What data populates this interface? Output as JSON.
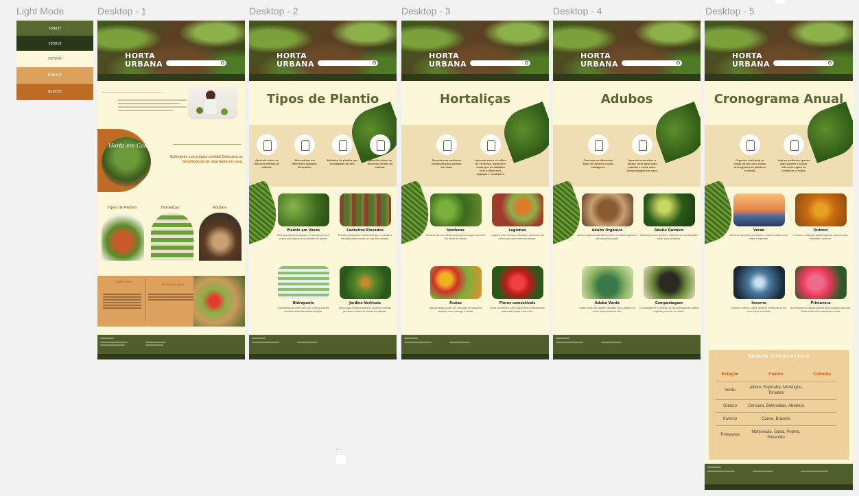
{
  "palette": {
    "title": "Light Mode",
    "swatches": [
      {
        "hex": "#59682F",
        "label": "59682F"
      },
      {
        "hex": "#283818",
        "label": "283818"
      },
      {
        "hex": "#FEF9DD",
        "label": "FEF9DD"
      },
      {
        "hex": "#DDA15E",
        "label": "DDA15E"
      },
      {
        "hex": "#BC6C25",
        "label": "BC6C25"
      }
    ]
  },
  "frames": {
    "d1": {
      "name": "Desktop - 1"
    },
    "d2": {
      "name": "Desktop - 2"
    },
    "d3": {
      "name": "Desktop - 3"
    },
    "d4": {
      "name": "Desktop - 4"
    },
    "d5": {
      "name": "Desktop - 5"
    }
  },
  "brand": {
    "logo_line1": "HORTA",
    "logo_line2": "URBANA"
  },
  "home": {
    "tagline": "Cultivando sua própria comida! Descubra os benefícios de ter uma horta em casa.",
    "topics": [
      "Tipos de Plantio",
      "Hortaliças",
      "Adubos"
    ],
    "promo_left": "Saiba mais",
    "promo_right": "Recursos úteis"
  },
  "tipos": {
    "title": "Tipos de Plantio",
    "features": [
      "Aprenda sobre os diversos formas de cultivar.",
      "Alternativas em diferentes espaços. Descubra!",
      "Métodos de plantio que se adaptam ao seu.",
      "Aprenda sobre os diversos formas de cultivar."
    ],
    "cards": [
      {
        "title": "Plantio em Vasos",
        "text": "Ideal para pequenos espaços, os vasos podem ser usados para cultivar uma variedade de plantas."
      },
      {
        "title": "Canteiros Elevados",
        "text": "Perfeitos para jardins e áreas externas, os canteiros elevados proporcionam um solo bem drenado."
      },
      {
        "title": "Hidroponia",
        "text": "Uma técnica de cultivo sem solo, onde as plantas recebem nutrientes através de água."
      },
      {
        "title": "Jardins Verticais",
        "text": "Ótimos para espaços limitados, os jardins verticais permitem o cultivo de plantas em paredes."
      }
    ]
  },
  "hortalicas": {
    "title": "Hortaliças",
    "features": [
      "Descubra as melhores hortaliças para cultivar em casa.",
      "Aprenda sobre o cultivo de verduras, legumes e ervas que se adaptam bem a diferentes espaços e condições."
    ],
    "cards": [
      {
        "title": "Verduras",
        "text": "Verduras são uma ótima escolha para começar sua horta. São fáceis de cultivar."
      },
      {
        "title": "Legumes",
        "text": "Legumes como cenoura, beterraba e abobrinha são ótimos para quem tem mais espaço."
      },
      {
        "title": "Frutas",
        "text": "Algumas frutas podem ser cultivadas em pequenos espaços, como morango e tomate."
      },
      {
        "title": "Flores comestíveis",
        "text": "Flores comestíveis como capuchinha e calêndula são adicionais bonitas à sua horta."
      }
    ]
  },
  "adubos": {
    "title": "Adubos",
    "features": [
      "Conheça os diferentes tipos de adubos e suas vantagens.",
      "Aprenda a escolher o adubo certo para suas plantas e como fazer compostagem em casa."
    ],
    "cards": [
      {
        "title": "Adubo Orgânico",
        "text": "Adubos orgânicos são feitos a partir de matéria orgânica e são uma ótima opção."
      },
      {
        "title": "Adubo Químico",
        "text": "Adubos químicos fornecem nutrientes de forma rápida e eficaz para as plantas."
      },
      {
        "title": "Adubo Verde",
        "text": "Adubo verde são plantas cultivadas com o objetivo de serem incorporadas ao solo."
      },
      {
        "title": "Compostagem",
        "text": "Compostagem é o processo de decomposição de matéria orgânica para criar um adubo."
      }
    ]
  },
  "cronograma": {
    "title": "Cronograma Anual",
    "features": [
      "Organize sua horta ao longo do ano com nosso cronograma de plantio e colheita.",
      "Veja as melhores épocas para plantar e colher diferentes tipos de hortaliças e frutas."
    ],
    "cards": [
      {
        "title": "Verão",
        "text": "No verão, aproveite para plantar e colher verduras como alface e espinafre."
      },
      {
        "title": "Outono",
        "text": "O outono é ideal para plantar legumes como cenoura, beterraba e abóbora."
      },
      {
        "title": "Inverno",
        "text": "Durante o inverno, cultive verduras resistentes ao frio, como couve e brócolis."
      },
      {
        "title": "Primavera",
        "text": "A primavera é a estação perfeita para revitalizar sua horta. Plante ervas como manjericão e salsa."
      }
    ],
    "table": {
      "caption": "Tabela de Cronograma Anual",
      "headers": [
        "Estação",
        "Plantio",
        "Colheita"
      ],
      "rows": [
        {
          "season": "Verão",
          "plant": "Alface, Espinafre, Morangos, Tomates",
          "harvest": ""
        },
        {
          "season": "Outono",
          "plant": "Cenoura, Beterrabas, Abóbora",
          "harvest": ""
        },
        {
          "season": "Inverno",
          "plant": "Couve, Brócolis",
          "harvest": ""
        },
        {
          "season": "Primavera",
          "plant": "Manjericão, Salsa, Pepino, Pimentão",
          "harvest": ""
        }
      ]
    }
  },
  "canvas": {
    "more_label": "..."
  }
}
